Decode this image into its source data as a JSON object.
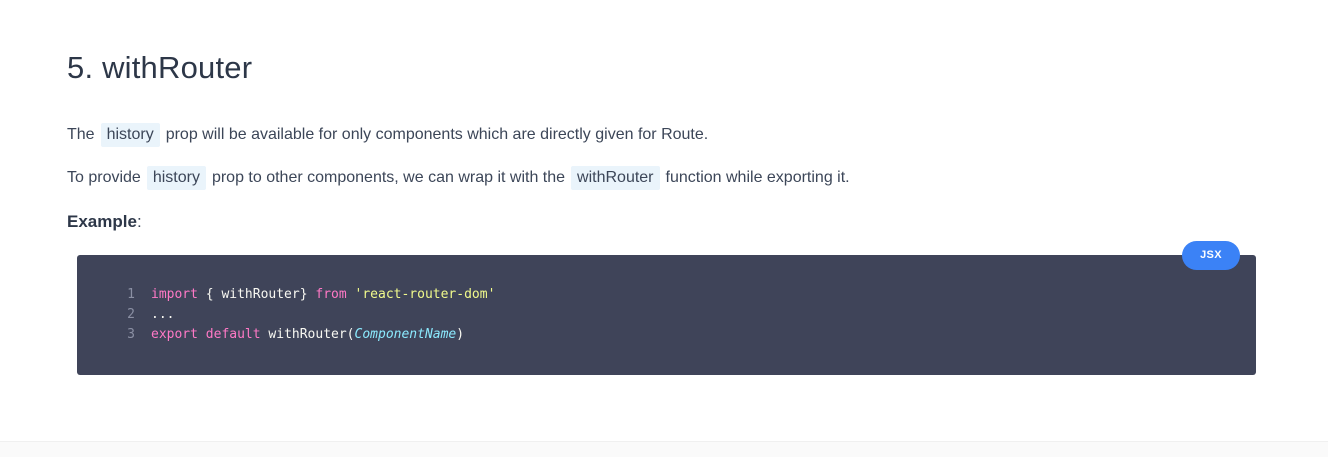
{
  "section": {
    "heading": "5. withRouter",
    "para1": {
      "before": "The",
      "code": "history",
      "after": "prop will be available for only components which are directly given for Route."
    },
    "para2": {
      "before": "To provide",
      "code1": "history",
      "middle": "prop to other components, we can wrap it with the",
      "code2": "withRouter",
      "after": "function while exporting it."
    },
    "example_label": "Example",
    "example_colon": ":"
  },
  "code_block": {
    "language": "JSX",
    "lines": [
      {
        "number": "1",
        "tokens": [
          {
            "text": "import",
            "kind": "keyword"
          },
          {
            "text": " { withRouter} ",
            "kind": "plain"
          },
          {
            "text": "from",
            "kind": "keyword"
          },
          {
            "text": " ",
            "kind": "plain"
          },
          {
            "text": "'react-router-dom'",
            "kind": "string"
          }
        ]
      },
      {
        "number": "2",
        "tokens": [
          {
            "text": "...",
            "kind": "plain"
          }
        ]
      },
      {
        "number": "3",
        "tokens": [
          {
            "text": "export",
            "kind": "keyword"
          },
          {
            "text": " ",
            "kind": "plain"
          },
          {
            "text": "default",
            "kind": "keyword"
          },
          {
            "text": " withRouter(",
            "kind": "plain"
          },
          {
            "text": "ComponentName",
            "kind": "italic"
          },
          {
            "text": ")",
            "kind": "plain"
          }
        ]
      }
    ],
    "colors": {
      "background": "#3f4459",
      "keyword": "#ff79c6",
      "string": "#f1fa8c",
      "italic": "#8be9fd",
      "badge": "#3b82f6"
    }
  }
}
